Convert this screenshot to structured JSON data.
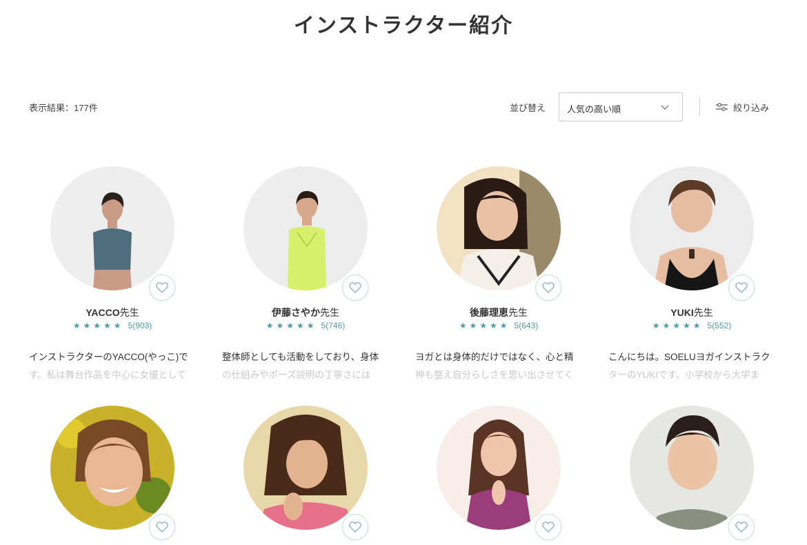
{
  "page": {
    "title": "インストラクター紹介"
  },
  "toolbar": {
    "result_count": "表示結果：177件",
    "sort_label": "並び替え",
    "sort_value": "人気の高い順",
    "filter_label": "絞り込み"
  },
  "instructors": [
    {
      "name": "YACCO",
      "suffix": "先生",
      "stars": "★★★★★",
      "rating": "5(903)",
      "bio_line1": "インストラクターのYACCO(やっこ)で",
      "bio_line2": "す。私は舞台作品を中心に女優として"
    },
    {
      "name": "伊藤さやか",
      "suffix": "先生",
      "stars": "★★★★★",
      "rating": "5(746)",
      "bio_line1": "整体師としても活動をしており、身体",
      "bio_line2": "の仕組みやポーズ説明の丁寧さには"
    },
    {
      "name": "後藤理恵",
      "suffix": "先生",
      "stars": "★★★★★",
      "rating": "5(643)",
      "bio_line1": "ヨガとは身体的だけではなく、心と精",
      "bio_line2": "神も整え自分らしさを思い出させてく"
    },
    {
      "name": "YUKI",
      "suffix": "先生",
      "stars": "★★★★★",
      "rating": "5(552)",
      "bio_line1": "こんにちは。SOELUヨガインストラク",
      "bio_line2": "ターのYUKIです。小学校から大学ま"
    }
  ],
  "colors": {
    "accent": "#4e9aa8",
    "fav_border": "#c7dde2",
    "faded_text": "#c9c9c9"
  },
  "icons": {
    "sort": "chevron-down-icon",
    "filter": "sliders-icon",
    "favorite": "heart-outline-icon"
  }
}
